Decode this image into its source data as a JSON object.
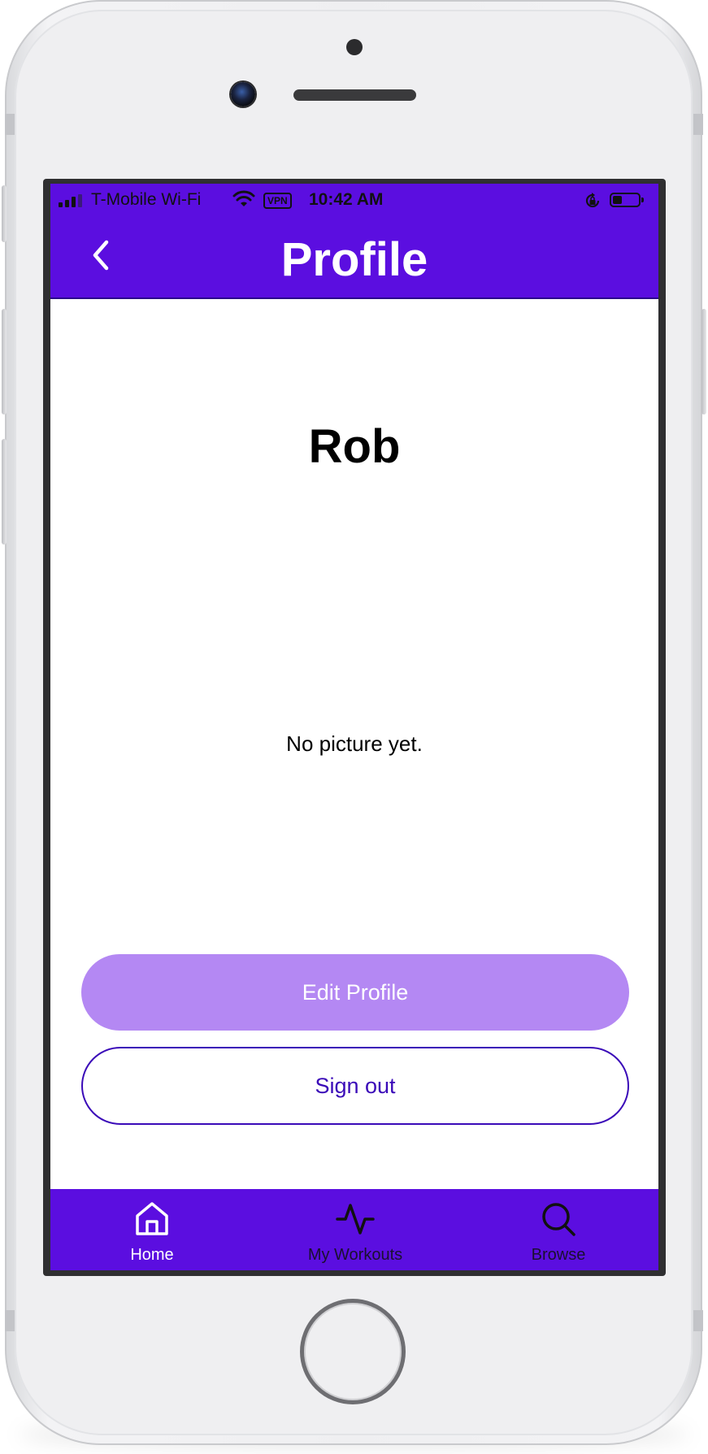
{
  "status_bar": {
    "carrier": "T-Mobile Wi-Fi",
    "vpn": "VPN",
    "time": "10:42 AM",
    "battery_level": 0.35,
    "signal_bars_active": 3
  },
  "nav": {
    "title": "Profile",
    "back_icon": "chevron-left-icon"
  },
  "profile": {
    "name": "Rob",
    "picture_placeholder": "No picture yet."
  },
  "actions": {
    "edit_profile_label": "Edit Profile",
    "sign_out_label": "Sign out"
  },
  "tab_bar": {
    "tabs": [
      {
        "label": "Home",
        "icon": "home-icon",
        "active": true
      },
      {
        "label": "My Workouts",
        "icon": "activity-icon",
        "active": false
      },
      {
        "label": "Browse",
        "icon": "search-icon",
        "active": false
      }
    ]
  },
  "colors": {
    "primary": "#5b0ee0",
    "button_fill": "#b488f3",
    "outline": "#3a0ab8",
    "background": "#ffffff"
  }
}
